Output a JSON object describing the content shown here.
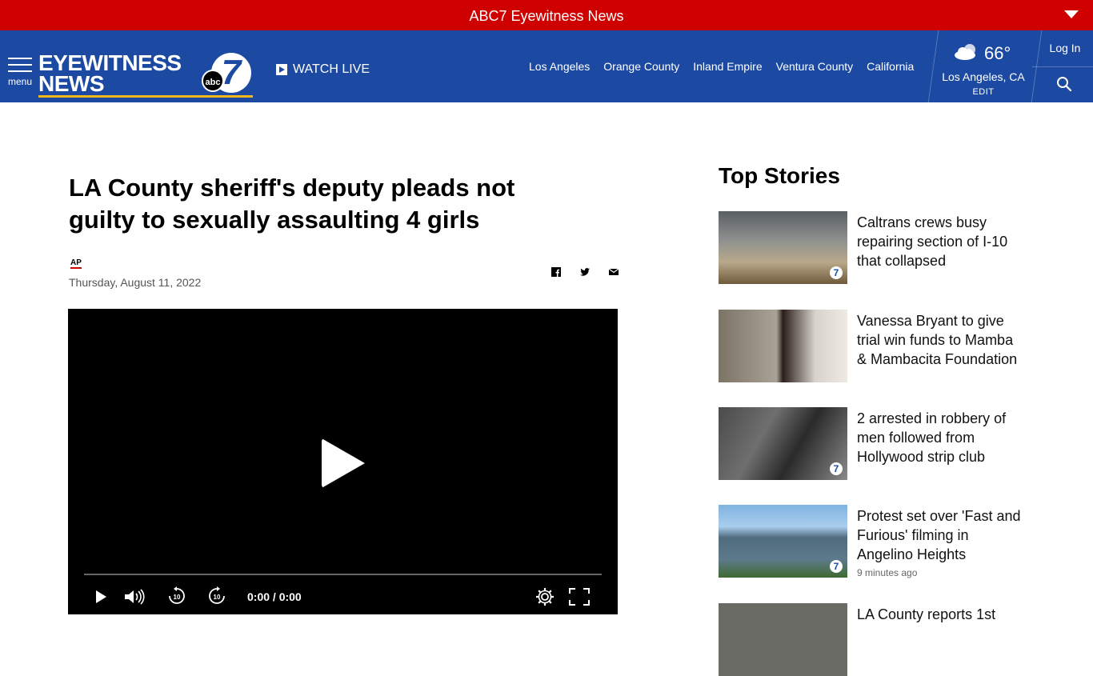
{
  "topbar": {
    "brand": "ABC7 Eyewitness News"
  },
  "nav": {
    "menu_label": "menu",
    "logo_line1": "EYEWITNESS",
    "logo_line2": "NEWS",
    "logo_network": "abc",
    "logo_channel": "7",
    "watch_live": "WATCH LIVE",
    "links": [
      "Los Angeles",
      "Orange County",
      "Inland Empire",
      "Ventura County",
      "California"
    ],
    "weather": {
      "temp": "66°",
      "location": "Los Angeles, CA",
      "edit": "EDIT"
    },
    "login": "Log In"
  },
  "article": {
    "headline": "LA County sheriff's deputy pleads not guilty to sexually assaulting 4 girls",
    "source": "AP",
    "date": "Thursday, August 11, 2022"
  },
  "video": {
    "time": "0:00 / 0:00",
    "skip_seconds": "10"
  },
  "top_stories": {
    "title": "Top Stories",
    "items": [
      {
        "text": "Caltrans crews busy repairing section of I-10 that collapsed",
        "ago": ""
      },
      {
        "text": "Vanessa Bryant to give trial win funds to Mamba & Mambacita Foundation",
        "ago": ""
      },
      {
        "text": "2 arrested in robbery of men followed from Hollywood strip club",
        "ago": ""
      },
      {
        "text": "Protest set over 'Fast and Furious' filming in Angelino Heights",
        "ago": "9 minutes ago"
      },
      {
        "text": "LA County reports 1st",
        "ago": ""
      }
    ]
  },
  "colors": {
    "brand_red": "#cf0000",
    "nav_blue": "#1c4aa2",
    "logo_gold": "#f2b81b"
  }
}
